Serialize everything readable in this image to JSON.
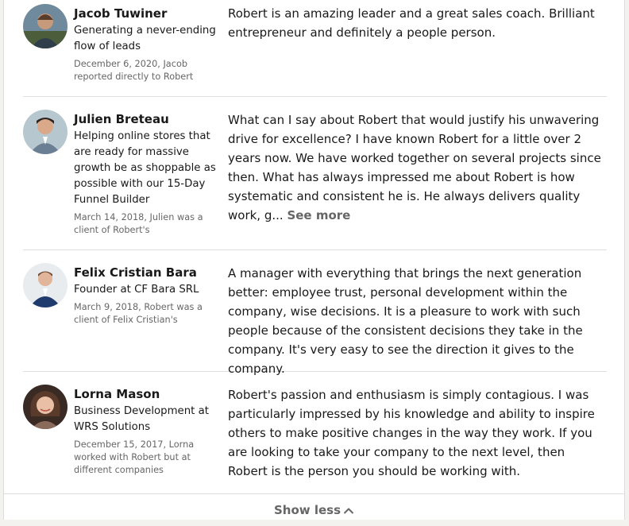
{
  "recommendations": [
    {
      "name": "Jacob Tuwiner",
      "headline": "Generating a never-ending flow of leads",
      "meta": "December 6, 2020, Jacob reported directly to Robert",
      "text": "Robert is an amazing leader and a great sales coach. Brilliant entrepreneur and definitely a people person.",
      "avatar_icon": "profile-photo"
    },
    {
      "name": "Julien Breteau",
      "headline": "Helping online stores that are ready for massive growth be as shoppable as possible with our 15-Day Funnel Builder",
      "meta": "March 14, 2018, Julien was a client of Robert's",
      "text": "What can I say about Robert that would justify his unwavering drive for excellence? I have known Robert for a little over 2 years now. We have worked together on several projects since then. What has always impressed me about Robert is how systematic and consistent he is. He always delivers quality work, g...",
      "see_more": "See more",
      "avatar_icon": "profile-photo"
    },
    {
      "name": "Felix Cristian Bara",
      "headline": "Founder at CF Bara SRL",
      "meta": "March 9, 2018, Robert was a client of Felix Cristian's",
      "text": "A manager with everything that brings the next generation better: employee trust, personal development within the company, wise decisions. It is a pleasure to work with such people because of the consistent decisions they take in the company. It's very easy to see the direction it gives to the company.",
      "avatar_icon": "profile-photo"
    },
    {
      "name": "Lorna Mason",
      "headline": "Business Development at WRS Solutions",
      "meta": "December 15, 2017, Lorna worked with Robert but at different companies",
      "text": "Robert's passion and enthusiasm is simply contagious. I was particularly impressed by his knowledge and ability to inspire others to make positive changes in the way they work. If you are looking to take your company to the next level, then Robert is the person you should be working with.",
      "avatar_icon": "profile-photo"
    }
  ],
  "footer": {
    "show_less_label": "Show less",
    "show_less_icon": "chevron-up-icon"
  },
  "colors": {
    "text": "#191919",
    "muted": "#666666",
    "divider": "#e0e0e0"
  }
}
